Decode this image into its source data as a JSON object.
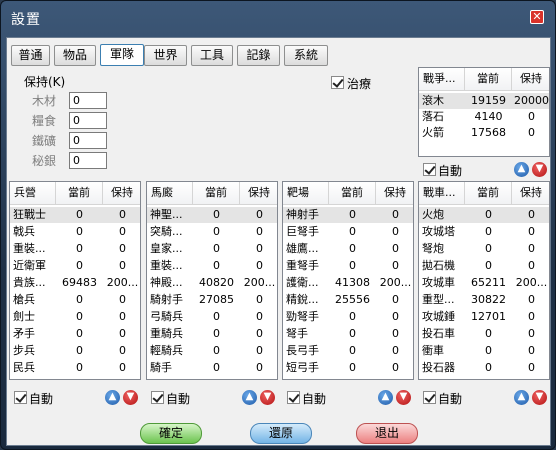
{
  "window": {
    "title": "設置",
    "close_label": "✕"
  },
  "tabs": [
    {
      "label": "普通",
      "active": false
    },
    {
      "label": "物品",
      "active": false
    },
    {
      "label": "軍隊",
      "active": true
    },
    {
      "label": "世界",
      "active": false
    },
    {
      "label": "工具",
      "active": false
    },
    {
      "label": "記錄",
      "active": false
    },
    {
      "label": "系統",
      "active": false
    }
  ],
  "keep": {
    "title": "保持(K)",
    "items": [
      {
        "label": "木材",
        "value": "0"
      },
      {
        "label": "糧食",
        "value": "0"
      },
      {
        "label": "鐵礦",
        "value": "0"
      },
      {
        "label": "秘銀",
        "value": "0"
      }
    ]
  },
  "heal": {
    "label": "治療",
    "checked": true
  },
  "special": {
    "headers": [
      "戰爭...",
      "當前",
      "保持"
    ],
    "rows": [
      [
        "滾木",
        "19159",
        "20000"
      ],
      [
        "落石",
        "4140",
        "0"
      ],
      [
        "火箭",
        "17568",
        "0"
      ]
    ],
    "auto_label": "自動"
  },
  "barracks": {
    "headers": [
      "兵營",
      "當前",
      "保持"
    ],
    "rows": [
      [
        "狂戰士",
        "0",
        "0"
      ],
      [
        "戟兵",
        "0",
        "0"
      ],
      [
        "重裝...",
        "0",
        "0"
      ],
      [
        "近衛軍",
        "0",
        "0"
      ],
      [
        "貴族...",
        "69483",
        "200..."
      ],
      [
        "槍兵",
        "0",
        "0"
      ],
      [
        "劍士",
        "0",
        "0"
      ],
      [
        "矛手",
        "0",
        "0"
      ],
      [
        "步兵",
        "0",
        "0"
      ],
      [
        "民兵",
        "0",
        "0"
      ]
    ],
    "auto_label": "自動"
  },
  "stable": {
    "headers": [
      "馬廄",
      "當前",
      "保持"
    ],
    "rows": [
      [
        "神聖...",
        "0",
        "0"
      ],
      [
        "突騎...",
        "0",
        "0"
      ],
      [
        "皇家...",
        "0",
        "0"
      ],
      [
        "重裝...",
        "0",
        "0"
      ],
      [
        "神殿...",
        "40820",
        "200..."
      ],
      [
        "騎射手",
        "27085",
        "0"
      ],
      [
        "弓騎兵",
        "0",
        "0"
      ],
      [
        "重騎兵",
        "0",
        "0"
      ],
      [
        "輕騎兵",
        "0",
        "0"
      ],
      [
        "騎手",
        "0",
        "0"
      ]
    ],
    "auto_label": "自動"
  },
  "range": {
    "headers": [
      "靶場",
      "當前",
      "保持"
    ],
    "rows": [
      [
        "神射手",
        "0",
        "0"
      ],
      [
        "巨弩手",
        "0",
        "0"
      ],
      [
        "雄鷹...",
        "0",
        "0"
      ],
      [
        "重弩手",
        "0",
        "0"
      ],
      [
        "護衛...",
        "41308",
        "200..."
      ],
      [
        "精銳...",
        "25556",
        "0"
      ],
      [
        "勁弩手",
        "0",
        "0"
      ],
      [
        "弩手",
        "0",
        "0"
      ],
      [
        "長弓手",
        "0",
        "0"
      ],
      [
        "短弓手",
        "0",
        "0"
      ]
    ],
    "auto_label": "自動"
  },
  "siege": {
    "headers": [
      "戰車...",
      "當前",
      "保持"
    ],
    "rows": [
      [
        "火炮",
        "0",
        "0"
      ],
      [
        "攻城塔",
        "0",
        "0"
      ],
      [
        "弩炮",
        "0",
        "0"
      ],
      [
        "拋石機",
        "0",
        "0"
      ],
      [
        "攻城車",
        "65211",
        "200..."
      ],
      [
        "重型...",
        "30822",
        "0"
      ],
      [
        "攻城錘",
        "12701",
        "0"
      ],
      [
        "投石車",
        "0",
        "0"
      ],
      [
        "衝車",
        "0",
        "0"
      ],
      [
        "投石器",
        "0",
        "0"
      ]
    ],
    "auto_label": "自動"
  },
  "buttons": {
    "ok": "確定",
    "restore": "還原",
    "exit": "退出"
  },
  "icons": {
    "up": "arrow-up-icon",
    "down": "arrow-down-icon"
  },
  "colors": {
    "up": "#1e5aa8",
    "down": "#b11212",
    "ok": "#6cc44f",
    "restore": "#73b4e6",
    "exit": "#ec8080"
  }
}
